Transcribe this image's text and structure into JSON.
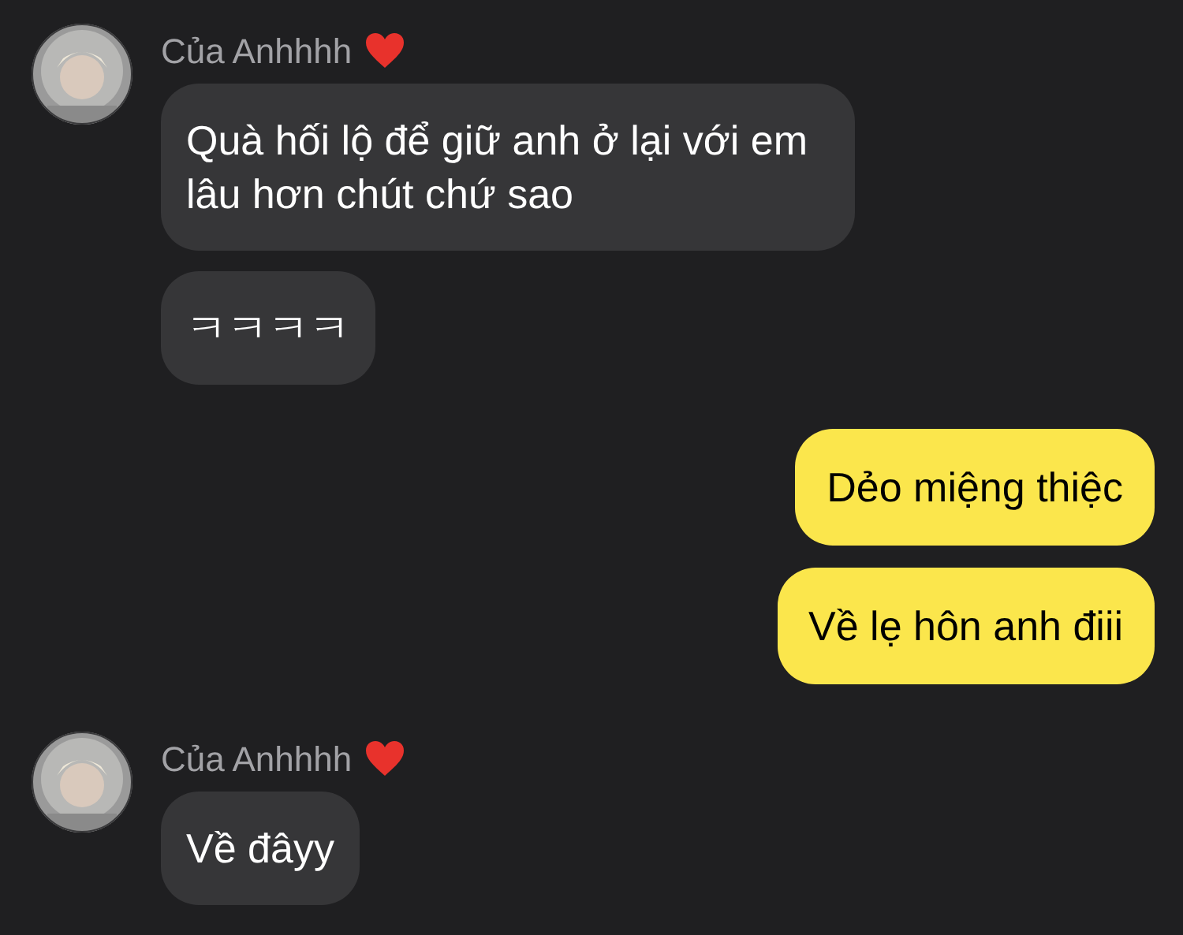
{
  "messages": [
    {
      "kind": "incoming",
      "sender": "Của Anhhhh",
      "bubbles": [
        "Quà hối lộ để giữ anh ở lại với em lâu hơn chút chứ sao",
        "ㅋㅋㅋㅋ"
      ]
    },
    {
      "kind": "outgoing",
      "bubbles": [
        "Dẻo miệng thiệc",
        "Về lẹ hôn anh điii"
      ]
    },
    {
      "kind": "incoming",
      "sender": "Của Anhhhh",
      "bubbles": [
        "Về đâyy"
      ]
    }
  ]
}
